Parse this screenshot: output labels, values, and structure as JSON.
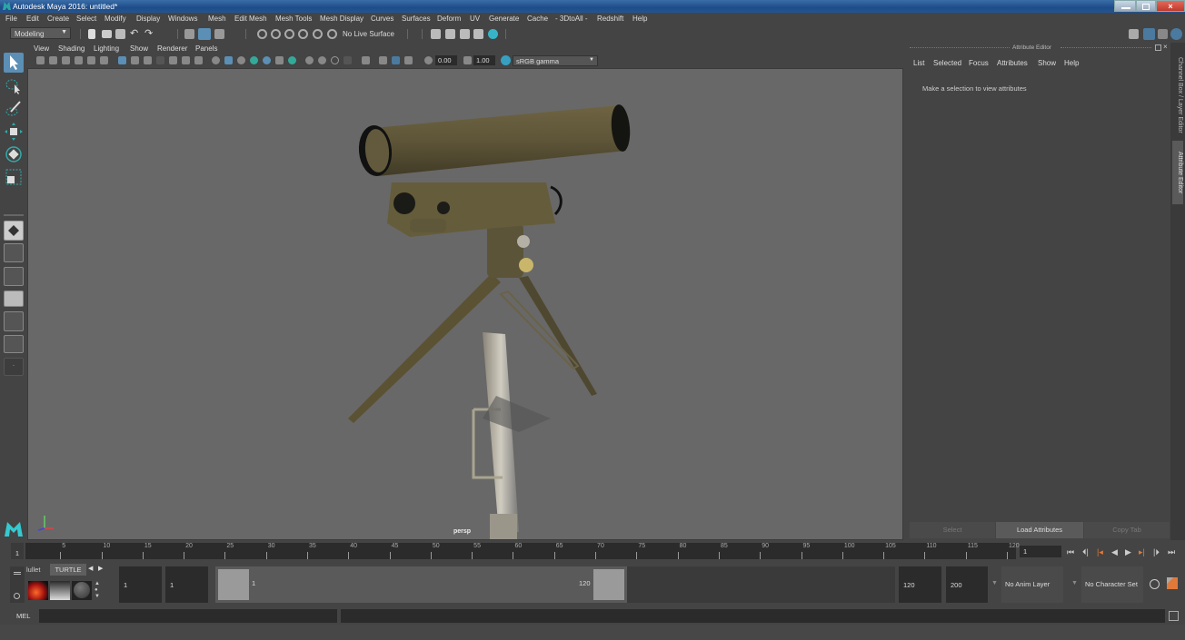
{
  "window": {
    "title": "Autodesk Maya 2016: untitled*",
    "close_glyph": "×"
  },
  "menubar": {
    "items": [
      "File",
      "Edit",
      "Create",
      "Select",
      "Modify",
      "Display",
      "Windows",
      "Mesh",
      "Edit Mesh",
      "Mesh Tools",
      "Mesh Display",
      "Curves",
      "Surfaces",
      "Deform",
      "UV",
      "Generate",
      "Cache",
      "- 3DtoAll -",
      "Redshift",
      "Help"
    ]
  },
  "shelf": {
    "mode_dropdown": "Modeling",
    "live_surface": "No Live Surface"
  },
  "viewport": {
    "menu": [
      "View",
      "Shading",
      "Lighting",
      "Show",
      "Renderer",
      "Panels"
    ],
    "exposure": "0.00",
    "gamma": "1.00",
    "color_space": "sRGB gamma",
    "camera_label": "persp"
  },
  "attribute_editor": {
    "header": "Attribute Editor",
    "menu": [
      "List",
      "Selected",
      "Focus",
      "Attributes",
      "Show",
      "Help"
    ],
    "message": "Make a selection to view attributes",
    "buttons": {
      "select": "Select",
      "load": "Load Attributes",
      "copy_tab": "Copy Tab"
    }
  },
  "side_tabs": {
    "channel_box": "Channel Box / Layer Editor",
    "attribute_editor": "Attribute Editor"
  },
  "timeline": {
    "ticks": [
      "5",
      "10",
      "15",
      "20",
      "25",
      "30",
      "35",
      "40",
      "45",
      "50",
      "55",
      "60",
      "65",
      "70",
      "75",
      "80",
      "85",
      "90",
      "95",
      "100",
      "105",
      "110",
      "115",
      "120"
    ],
    "current_marker": "1",
    "current_frame": "1",
    "range_start": 1,
    "range_end": 120
  },
  "range": {
    "start_time": "1",
    "playback_start": "1",
    "slider_start_label": "1",
    "slider_end_label": "120",
    "playback_end": "120",
    "end_time": "200",
    "anim_layer": "No Anim Layer",
    "character_set": "No Character Set"
  },
  "shelf_tabs": {
    "tab_partial": "lullet",
    "tab_active": "TURTLE"
  },
  "command_line": {
    "label": "MEL",
    "value": "",
    "result": ""
  }
}
